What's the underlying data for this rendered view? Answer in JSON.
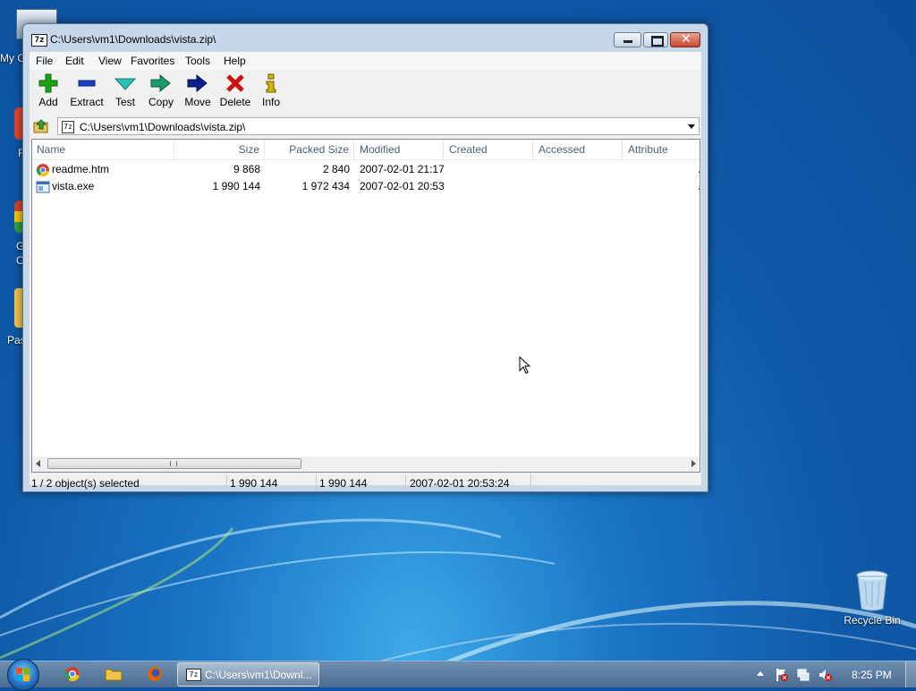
{
  "window": {
    "title": "C:\\Users\\vm1\\Downloads\\vista.zip\\",
    "app_badge": "7z"
  },
  "menu": [
    "File",
    "Edit",
    "View",
    "Favorites",
    "Tools",
    "Help"
  ],
  "toolbar": [
    {
      "label": "Add",
      "icon": "plus-icon",
      "color": "#1aa31a"
    },
    {
      "label": "Extract",
      "icon": "minus-icon",
      "color": "#1a3fbf"
    },
    {
      "label": "Test",
      "icon": "check-icon",
      "color": "#2bc0b0"
    },
    {
      "label": "Copy",
      "icon": "double-arrow-icon",
      "color": "#1a9a6a"
    },
    {
      "label": "Move",
      "icon": "arrow-right-icon",
      "color": "#0a1f8f"
    },
    {
      "label": "Delete",
      "icon": "x-icon",
      "color": "#d01010"
    },
    {
      "label": "Info",
      "icon": "info-icon",
      "color": "#d6b800"
    }
  ],
  "address": {
    "path": "C:\\Users\\vm1\\Downloads\\vista.zip\\"
  },
  "columns": [
    "Name",
    "Size",
    "Packed Size",
    "Modified",
    "Created",
    "Accessed",
    "Attribute"
  ],
  "files": [
    {
      "name": "readme.htm",
      "size": "9 868",
      "packed": "2 840",
      "modified": "2007-02-01 21:17",
      "attr": "A",
      "icon": "chrome-file-icon"
    },
    {
      "name": "vista.exe",
      "size": "1 990 144",
      "packed": "1 972 434",
      "modified": "2007-02-01 20:53",
      "attr": "A",
      "icon": "exe-file-icon"
    }
  ],
  "status": {
    "selection": "1 / 2 object(s) selected",
    "size": "1 990 144",
    "packed": "1 990 144",
    "modified": "2007-02-01 20:53:24"
  },
  "desktop": {
    "recycle_bin": "Recycle Bin",
    "left_labels": [
      "My C",
      "F",
      "G",
      "C",
      "Pas"
    ]
  },
  "taskbar": {
    "active_window": "C:\\Users\\vm1\\Downl...",
    "clock": "8:25 PM"
  },
  "colors": {
    "desktop": "#0f5aa8",
    "accent_red_close": "#c9452c"
  }
}
